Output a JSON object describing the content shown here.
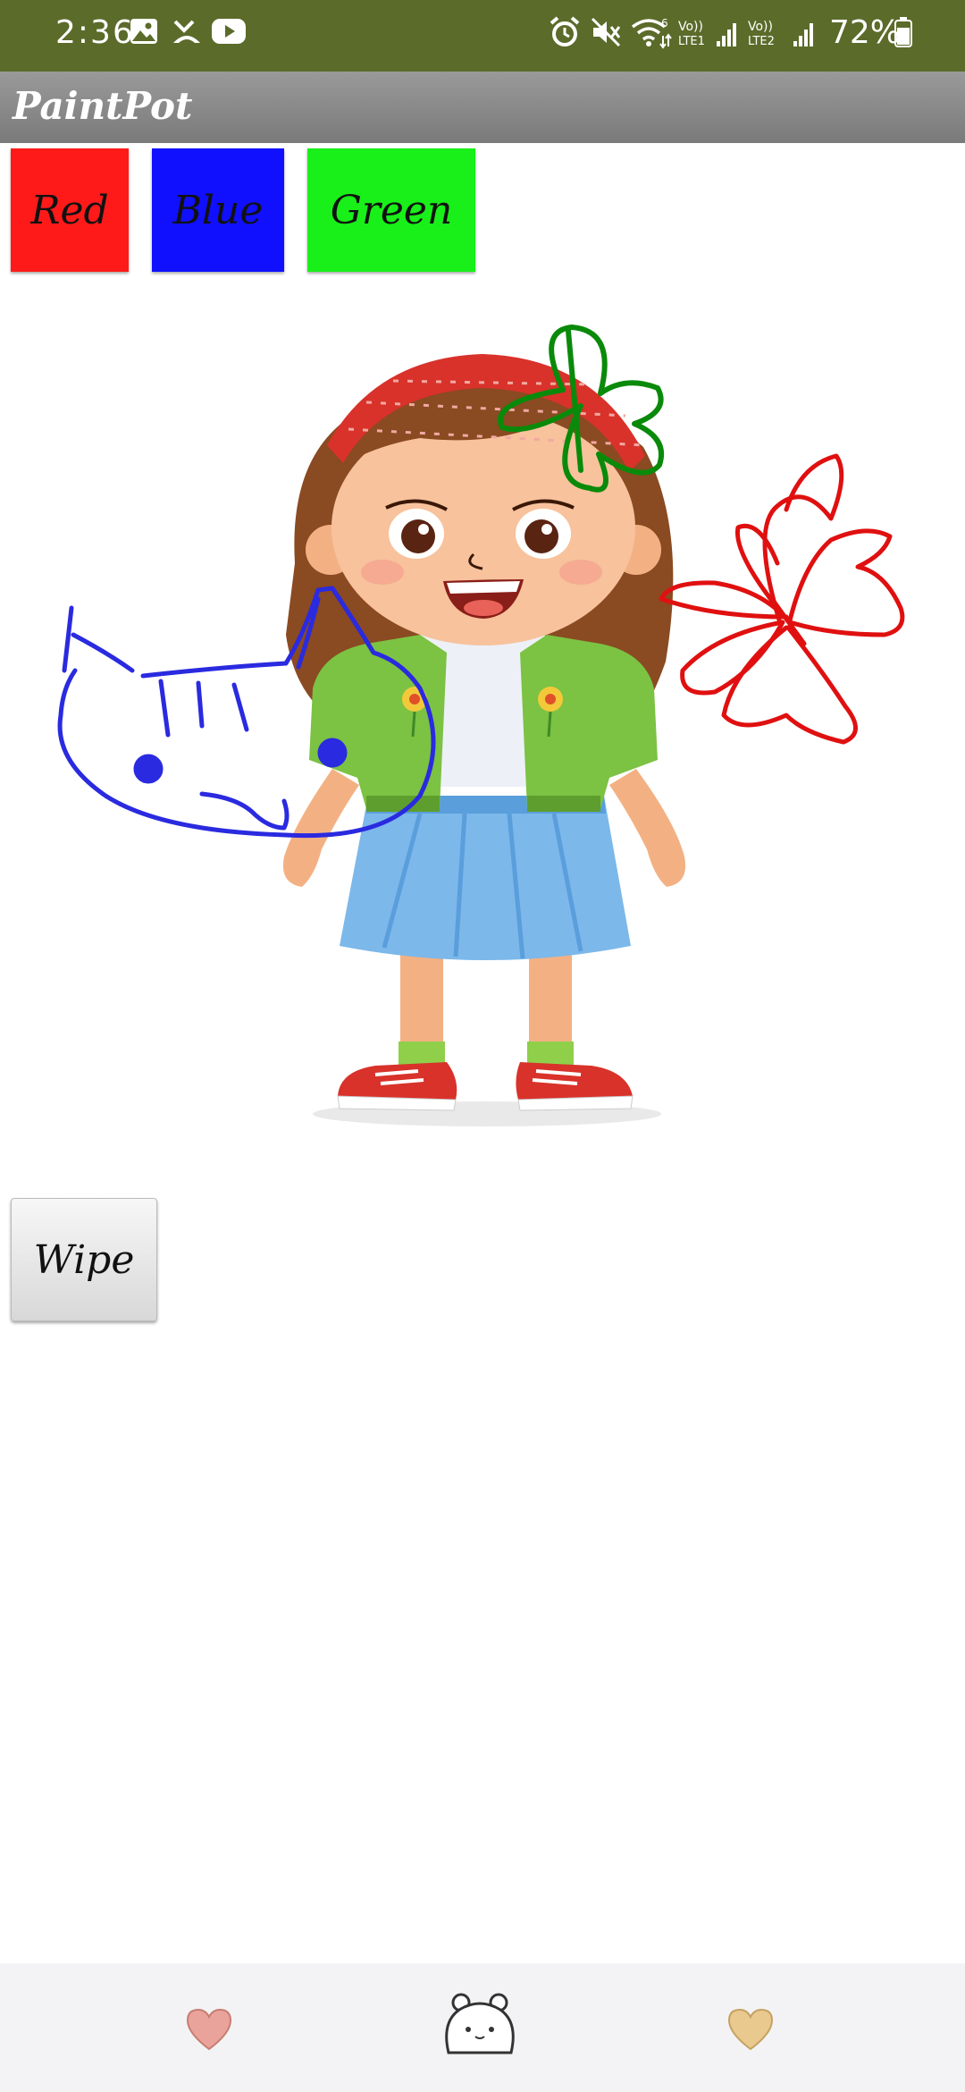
{
  "status_bar": {
    "time": "2:36",
    "battery": "72%",
    "icons": [
      "gallery-icon",
      "missed-call-icon",
      "youtube-icon",
      "alarm-icon",
      "mute-icon",
      "wifi-icon",
      "lte1-signal-icon",
      "lte2-signal-icon",
      "battery-icon"
    ],
    "color": "#5b6b2a"
  },
  "app_bar": {
    "title": "PaintPot"
  },
  "color_buttons": [
    {
      "label": "Red",
      "color": "#ff1a1a"
    },
    {
      "label": "Blue",
      "color": "#1010ff"
    },
    {
      "label": "Green",
      "color": "#19f019"
    }
  ],
  "canvas": {
    "background_image": "cartoon-girl",
    "drawings": [
      {
        "name": "green-flower-drawing",
        "color": "#0a8a0a"
      },
      {
        "name": "blue-cat-drawing",
        "color": "#2a2ae0"
      },
      {
        "name": "red-flower-drawing",
        "color": "#e01010"
      }
    ]
  },
  "wipe_button": {
    "label": "Wipe"
  },
  "bottom_bar": {
    "icons": [
      "heart-icon",
      "bear-icon",
      "heart-icon"
    ],
    "colors": {
      "left_heart": "#eaa39a",
      "right_heart": "#e9c98e"
    }
  }
}
